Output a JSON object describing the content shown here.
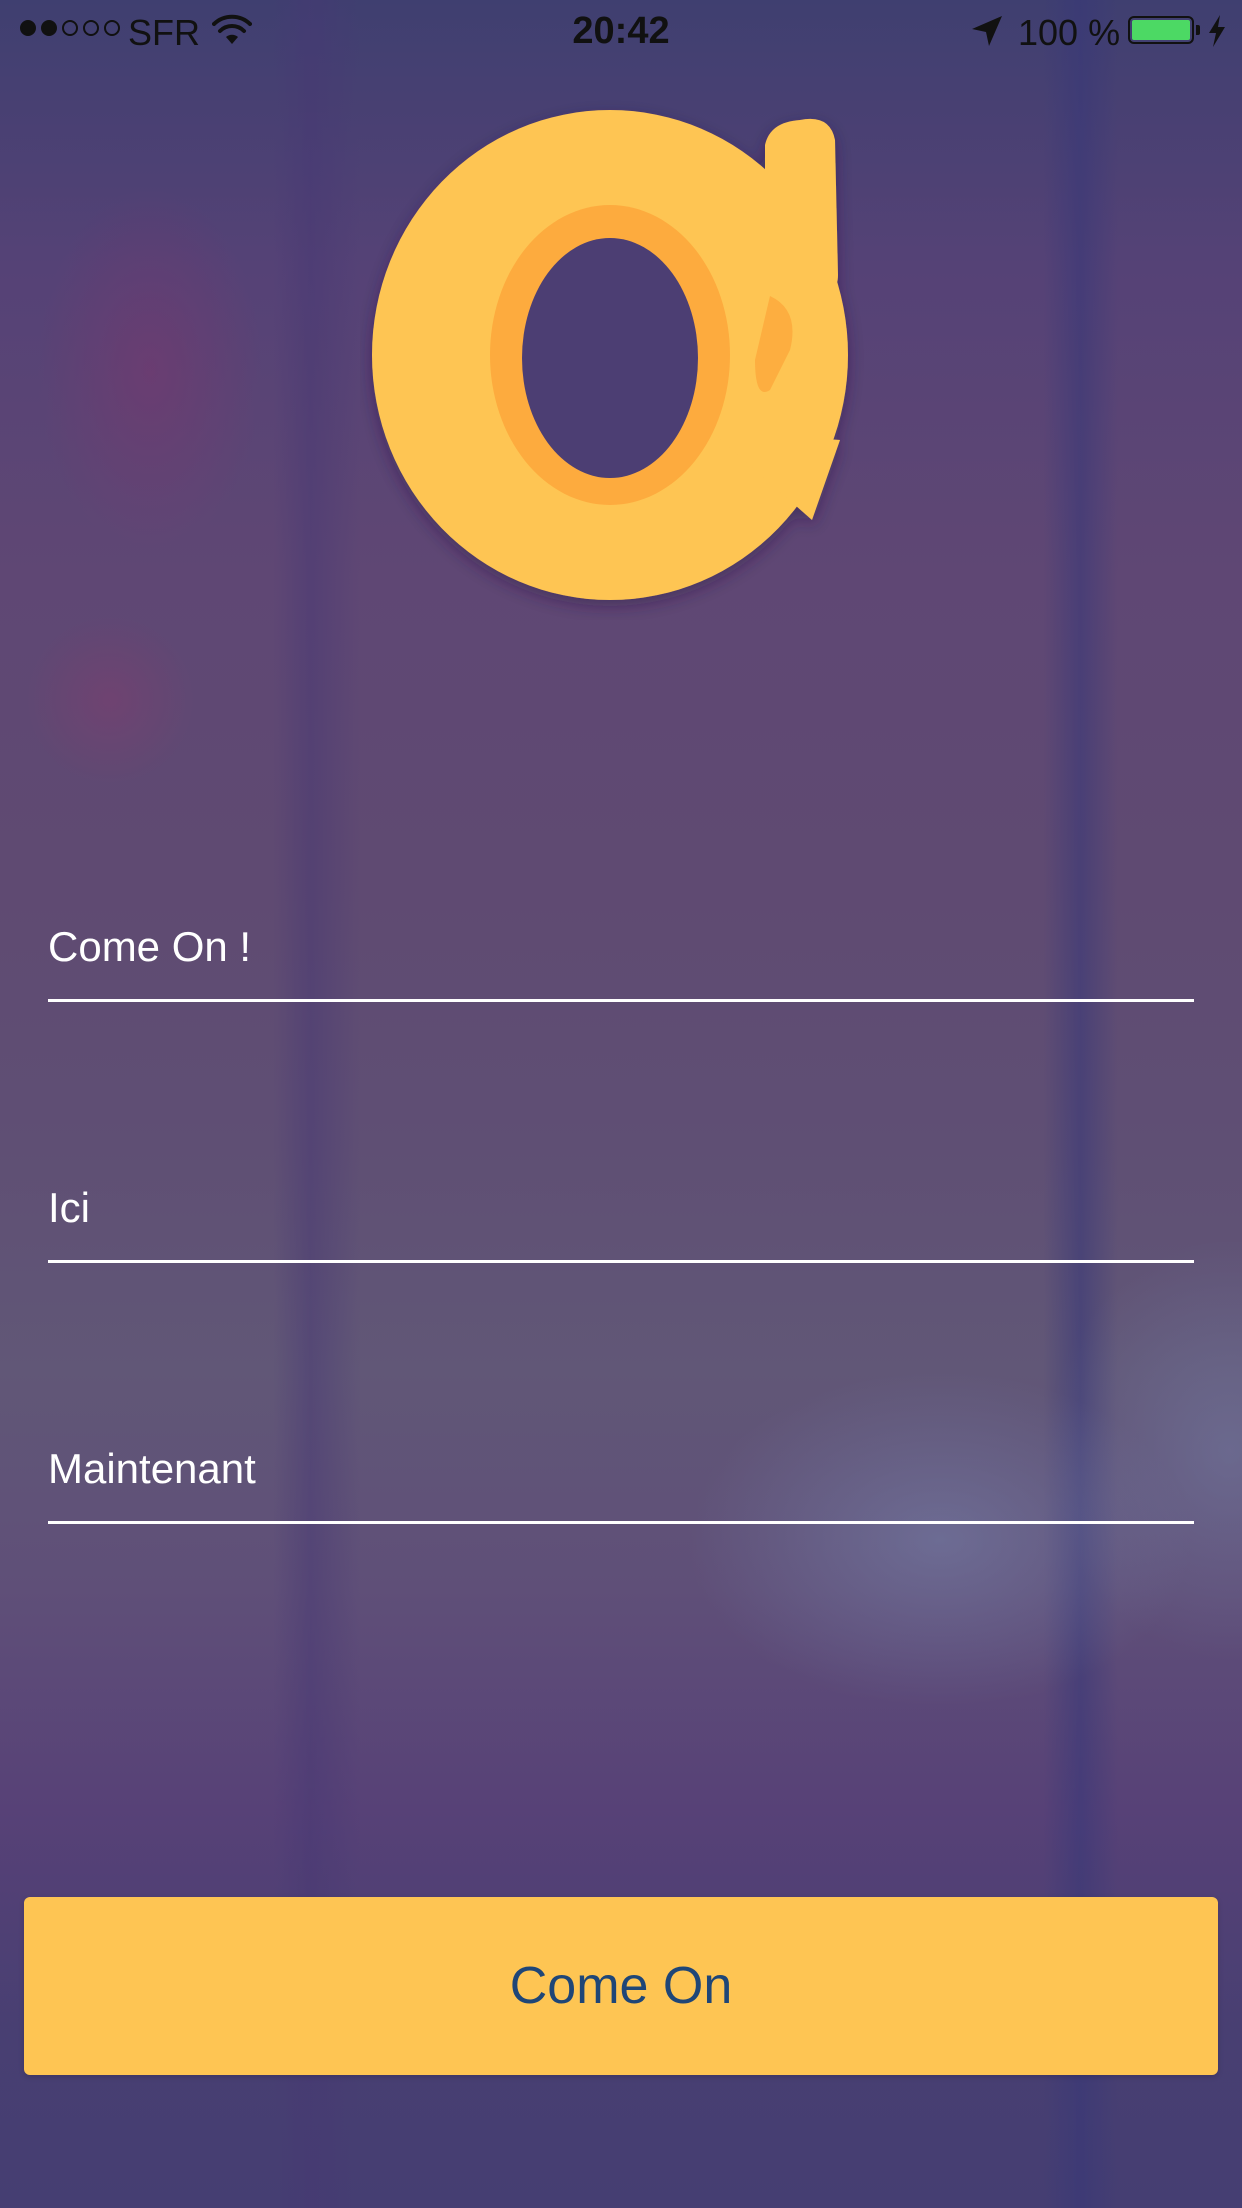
{
  "status_bar": {
    "carrier": "SFR",
    "signal_bars_filled": 2,
    "signal_bars_total": 5,
    "time": "20:42",
    "battery_percent": "100 %",
    "battery_level": 1.0,
    "battery_color": "#4cd964",
    "icons": [
      "wifi-icon",
      "location-arrow-icon",
      "battery-icon",
      "charging-bolt-icon"
    ]
  },
  "logo": {
    "icon": "app-logo-c-arrow-icon",
    "color": "#fec553",
    "inner_color": "#fdab3e"
  },
  "form": {
    "fields": [
      {
        "placeholder": "Come On !",
        "value": ""
      },
      {
        "placeholder": "Ici",
        "value": ""
      },
      {
        "placeholder": "Maintenant",
        "value": ""
      }
    ],
    "submit_label": "Come On"
  },
  "colors": {
    "accent": "#fec553",
    "button_text": "#1f4677",
    "text": "#ffffff",
    "background": "#5a4676"
  }
}
